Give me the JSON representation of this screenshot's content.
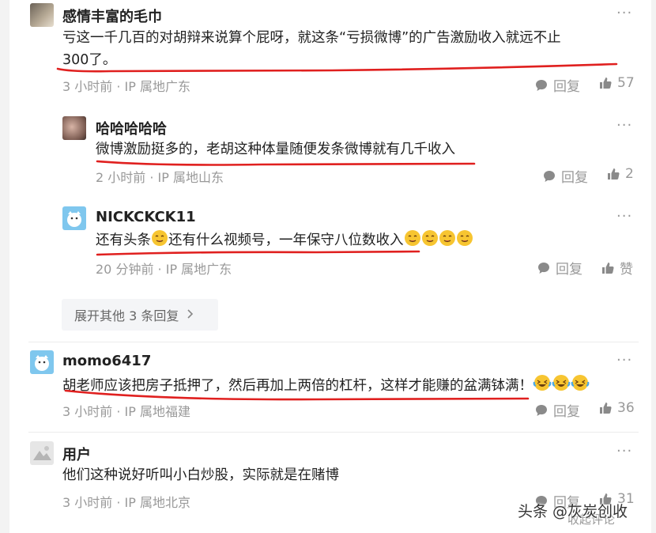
{
  "comments": [
    {
      "user": "感情丰富的毛巾",
      "text_line1": "亏这一千几百的对胡辩来说算个屁呀，就这条“亏损微博”的广告激励收入就远不止",
      "text_line2": "300了。",
      "time": "3 小时前",
      "ip": "IP 属地广东",
      "reply_label": "回复",
      "likes": "57"
    },
    {
      "user": "用户",
      "text": "他们这种说好听叫小白炒股，实际就是在赌博",
      "time": "3 小时前",
      "ip": "IP 属地北京",
      "reply_label": "回复",
      "likes": "31"
    },
    {
      "user": "momo6417",
      "text": "胡老师应该把房子抵押了，然后再加上两倍的杠杆，这样才能赚的盆满钵满！",
      "time": "3 小时前",
      "ip": "IP 属地福建",
      "reply_label": "回复",
      "likes": "36"
    }
  ],
  "replies": [
    {
      "user": "哈哈哈哈哈",
      "text": "微博激励挺多的，老胡这种体量随便发条微博就有几千收入",
      "time": "2 小时前",
      "ip": "IP 属地山东",
      "reply_label": "回复",
      "likes": "2"
    },
    {
      "user": "NICKCKCK11",
      "text_a": "还有头条",
      "text_b": "还有什么视频号，一年保守八位数收入",
      "time": "20 分钟前",
      "ip": "IP 属地广东",
      "reply_label": "回复",
      "likes": "赞"
    }
  ],
  "expand_label": "展开其他 3 条回复",
  "more_label": "···",
  "watermark": "头条 @灰炭创收",
  "collapse_label": "收起评论",
  "colors": {
    "underline": "#e0201f",
    "muted": "#999999",
    "bubble": "#f4f5f7"
  },
  "icons": [
    "reply-icon",
    "like-icon",
    "chevron-right-icon",
    "more-icon",
    "drooling-emoji",
    "laughing-crying-emoji"
  ]
}
